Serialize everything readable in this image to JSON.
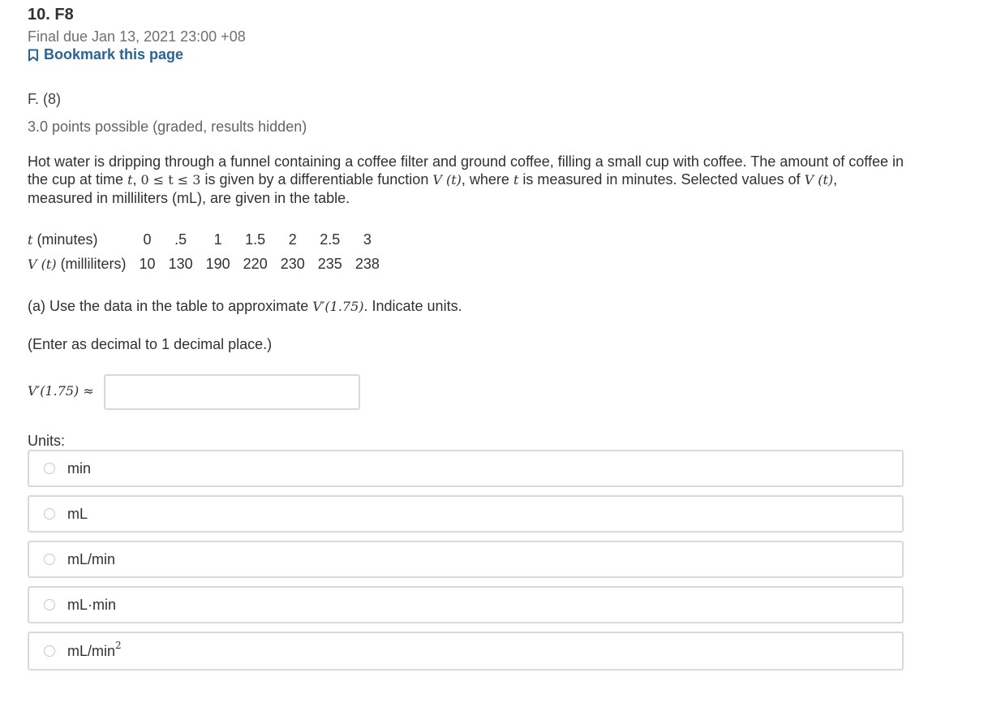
{
  "header": {
    "title": "10. F8",
    "due": "Final due Jan 13, 2021 23:00 +08",
    "bookmark_label": "Bookmark this page"
  },
  "problem": {
    "name": "F. (8)",
    "points": "3.0 points possible (graded, results hidden)",
    "prompt": {
      "p1": "Hot water is dripping through a funnel containing a coffee filter and ground coffee, filling a small cup with coffee. The amount of coffee in the cup at time ",
      "t1": "t",
      "p2": ",  ",
      "ineq": "0 ≤ t ≤ 3",
      "p3": " is given by a differentiable function ",
      "vt": "V (t)",
      "p4": ", where ",
      "t2": "t",
      "p5": " is measured in minutes. Selected values of ",
      "vt2": "V (t)",
      "p6": ", measured in milliliters (mL), are given in the table."
    }
  },
  "table": {
    "row1_head_var": "t",
    "row1_head_text": " (minutes)",
    "row2_head_var": "V (t)",
    "row2_head_text": " (milliliters)",
    "t_values": [
      "0",
      ".5",
      "1",
      "1.5",
      "2",
      "2.5",
      "3"
    ],
    "v_values": [
      "10",
      "130",
      "190",
      "220",
      "230",
      "235",
      "238"
    ]
  },
  "part_a": {
    "text_before": "(a) Use the data in the table to approximate ",
    "expr": "V′(1.75)",
    "text_after": ". Indicate units.",
    "hint": "(Enter as decimal to 1 decimal place.)",
    "answer_label": "V′(1.75) ≈",
    "answer_value": ""
  },
  "units": {
    "label": "Units:",
    "options": [
      "min",
      "mL",
      "mL/min",
      "mL·min",
      "mL/min"
    ],
    "last_superscript": "2"
  },
  "colors": {
    "link": "#2a6496",
    "muted": "#707070",
    "border": "#d9d9d9"
  }
}
